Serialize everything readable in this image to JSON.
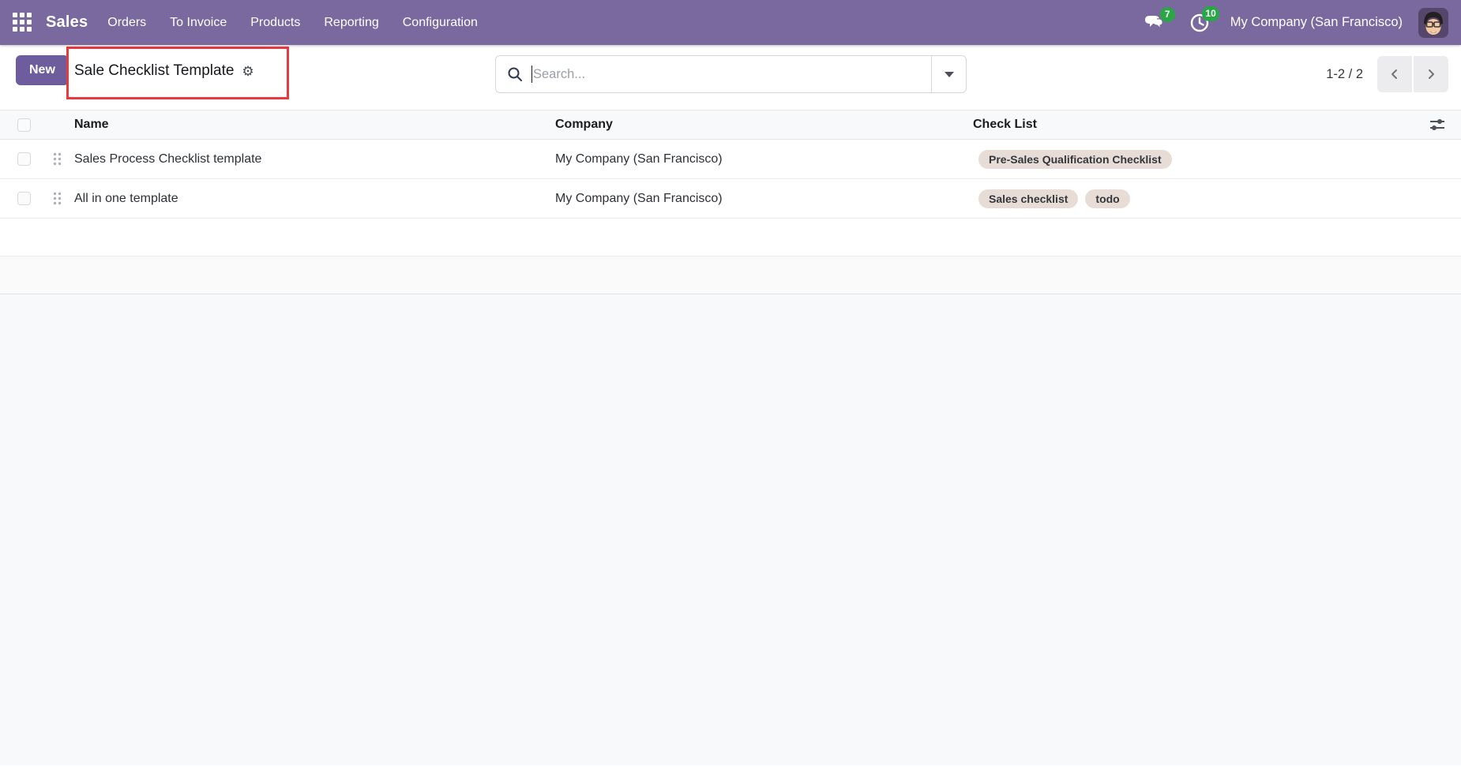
{
  "navbar": {
    "app_name": "Sales",
    "menu": [
      "Orders",
      "To Invoice",
      "Products",
      "Reporting",
      "Configuration"
    ],
    "messages_count": "7",
    "activities_count": "10",
    "company": "My Company (San Francisco)"
  },
  "control": {
    "new_label": "New",
    "title": "Sale Checklist Template",
    "search_placeholder": "Search...",
    "pager_text": "1-2 / 2"
  },
  "table": {
    "columns": [
      "Name",
      "Company",
      "Check List"
    ],
    "rows": [
      {
        "name": "Sales Process Checklist template",
        "company": "My Company (San Francisco)",
        "tags": [
          "Pre-Sales Qualification Checklist"
        ]
      },
      {
        "name": "All in one template",
        "company": "My Company (San Francisco)",
        "tags": [
          "Sales checklist",
          "todo"
        ]
      }
    ]
  },
  "icons": {
    "apps": "grid-3x3",
    "messages": "chat-bubbles",
    "activities": "clock",
    "search": "magnifier",
    "search_toggle": "caret-down",
    "title_action": "gear",
    "row_handle": "six-dots",
    "optional_columns": "sliders",
    "pager_prev": "chevron-left",
    "pager_next": "chevron-right"
  },
  "colors": {
    "navbar_bg": "#79699e",
    "primary_button": "#6d5d9c",
    "badge_green": "#28a745",
    "tag_bg": "#e8ddd6",
    "annotation_red": "#e8393d"
  }
}
